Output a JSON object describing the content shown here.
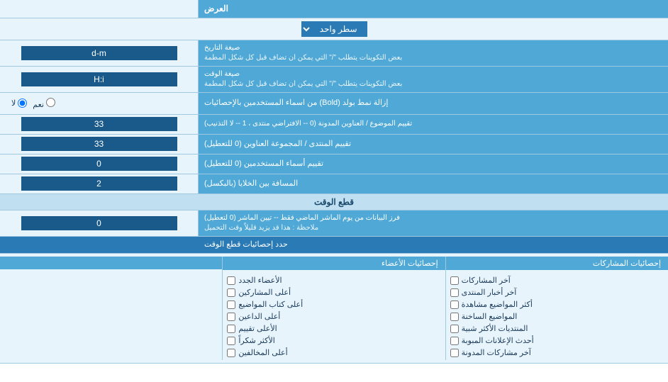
{
  "header": {
    "title": "العرض"
  },
  "dropdown_row": {
    "label": "سطر واحد"
  },
  "rows": [
    {
      "id": "date_format",
      "label": "صيغة التاريخ",
      "sublabel": "بعض التكوينات يتطلب \"/\" التي يمكن ان تضاف قبل كل شكل المطمة",
      "input_value": "d-m",
      "type": "text"
    },
    {
      "id": "time_format",
      "label": "صيغة الوقت",
      "sublabel": "بعض التكوينات يتطلب \"/\" التي يمكن ان تضاف قبل كل شكل المطمة",
      "input_value": "H:i",
      "type": "text"
    },
    {
      "id": "bold_remove",
      "label": "إزالة نمط بولد (Bold) من اسماء المستخدمين بالإحصائيات",
      "type": "radio",
      "radio_yes": "نعم",
      "radio_no": "لا",
      "selected": "no"
    },
    {
      "id": "topic_order",
      "label": "تقييم الموضوع / العناوين المدونة (0 -- الافتراضي منتدى ، 1 -- لا التذنيب)",
      "input_value": "33",
      "type": "text"
    },
    {
      "id": "forum_order",
      "label": "تقييم المنتدى / المجموعة العناوين (0 للتعطيل)",
      "input_value": "33",
      "type": "text"
    },
    {
      "id": "users_names",
      "label": "تقييم أسماء المستخدمين (0 للتعطيل)",
      "input_value": "0",
      "type": "text"
    },
    {
      "id": "cell_spacing",
      "label": "المسافة بين الخلايا (بالبكسل)",
      "input_value": "2",
      "type": "text"
    }
  ],
  "section_realtime": {
    "title": "قطع الوقت"
  },
  "realtime_row": {
    "label_main": "فرز البيانات من يوم الماشر الماضي فقط -- تيين الماشر (0 لتعطيل)",
    "label_note": "ملاحظة : هذا قد يزيد قليلاً وقت التحميل",
    "input_value": "0"
  },
  "stats_header": {
    "label": "حدد إحصائيات قطع الوقت"
  },
  "checkboxes": {
    "col1_header": "إحصائيات المشاركات",
    "col2_header": "إحصائيات الأعضاء",
    "col3_header": "",
    "col1_items": [
      {
        "label": "آخر المشاركات",
        "checked": false
      },
      {
        "label": "آخر أخبار المنتدى",
        "checked": false
      },
      {
        "label": "أكثر المواضيع مشاهدة",
        "checked": false
      },
      {
        "label": "المواضيع الساخنة",
        "checked": false
      },
      {
        "label": "المنتديات الأكثر شبية",
        "checked": false
      },
      {
        "label": "أحدث الإعلانات المبوبة",
        "checked": false
      },
      {
        "label": "آخر مشاركات المدونة",
        "checked": false
      }
    ],
    "col2_items": [
      {
        "label": "الأعضاء الجدد",
        "checked": false
      },
      {
        "label": "أعلى المشاركين",
        "checked": false
      },
      {
        "label": "أعلى كتاب المواضيع",
        "checked": false
      },
      {
        "label": "أعلى الداعين",
        "checked": false
      },
      {
        "label": "الأعلى تقييم",
        "checked": false
      },
      {
        "label": "الأكثر شكراً",
        "checked": false
      },
      {
        "label": "أعلى المخالفين",
        "checked": false
      }
    ]
  }
}
